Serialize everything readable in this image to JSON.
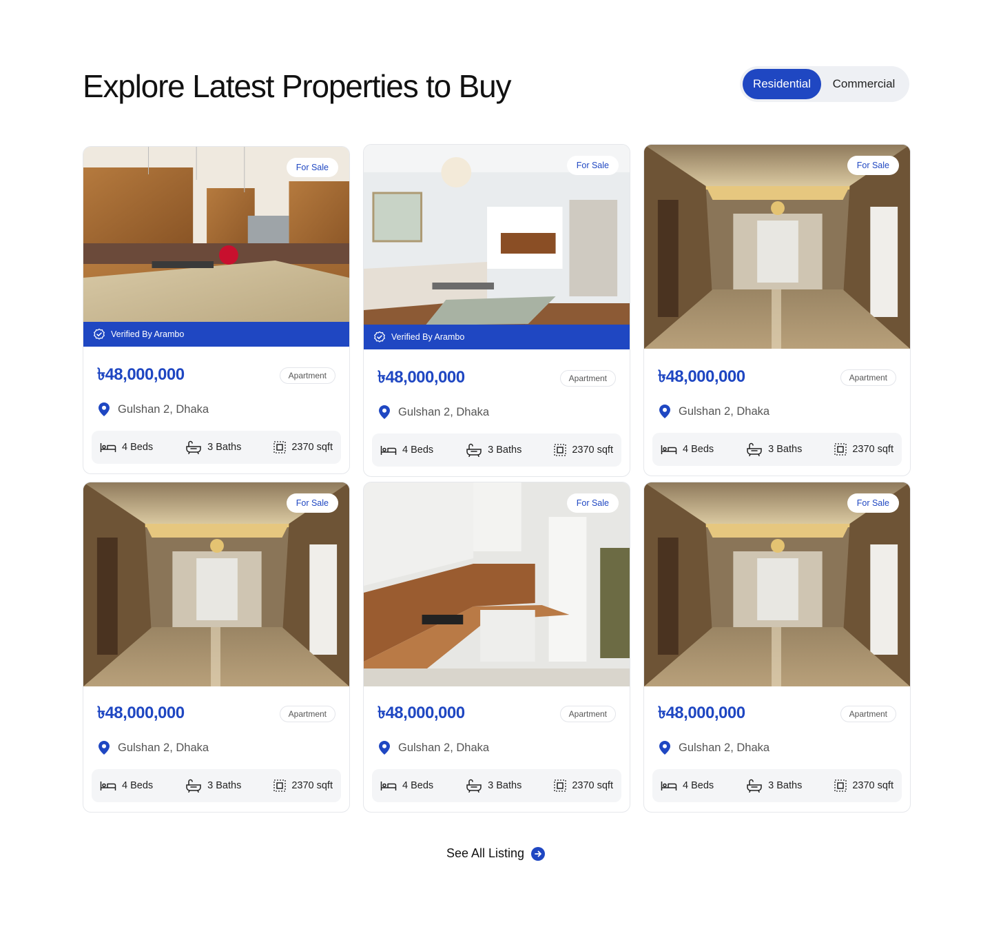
{
  "section": {
    "title": "Explore Latest Properties to Buy",
    "tabs": [
      {
        "label": "Residential",
        "active": true
      },
      {
        "label": "Commercial",
        "active": false
      }
    ]
  },
  "listings": [
    {
      "status": "For Sale",
      "verified_label": "Verified By Arambo",
      "price": "৳48,000,000",
      "type": "Apartment",
      "location": "Gulshan 2, Dhaka",
      "beds": "4 Beds",
      "baths": "3 Baths",
      "area": "2370 sqft",
      "photo": "kitchen-island"
    },
    {
      "status": "For Sale",
      "verified_label": "Verified By Arambo",
      "price": "৳48,000,000",
      "type": "Apartment",
      "location": "Gulshan 2, Dhaka",
      "beds": "4 Beds",
      "baths": "3 Baths",
      "area": "2370 sqft",
      "photo": "living-room"
    },
    {
      "status": "For Sale",
      "price": "৳48,000,000",
      "type": "Apartment",
      "location": "Gulshan 2, Dhaka",
      "beds": "4 Beds",
      "baths": "3 Baths",
      "area": "2370 sqft",
      "photo": "empty-hall"
    },
    {
      "status": "For Sale",
      "price": "৳48,000,000",
      "type": "Apartment",
      "location": "Gulshan 2, Dhaka",
      "beds": "4 Beds",
      "baths": "3 Baths",
      "area": "2370 sqft",
      "photo": "empty-hall"
    },
    {
      "status": "For Sale",
      "price": "৳48,000,000",
      "type": "Apartment",
      "location": "Gulshan 2, Dhaka",
      "beds": "4 Beds",
      "baths": "3 Baths",
      "area": "2370 sqft",
      "photo": "modern-kitchen"
    },
    {
      "status": "For Sale",
      "price": "৳48,000,000",
      "type": "Apartment",
      "location": "Gulshan 2, Dhaka",
      "beds": "4 Beds",
      "baths": "3 Baths",
      "area": "2370 sqft",
      "photo": "empty-hall"
    }
  ],
  "footer": {
    "see_all_label": "See All Listing"
  },
  "colors": {
    "accent": "#1f47c2",
    "pill_bg": "#eef0f4",
    "stats_bg": "#f4f5f7"
  },
  "icons": [
    "verified-icon",
    "location-pin-icon",
    "bed-icon",
    "bathtub-icon",
    "area-icon",
    "arrow-right-icon"
  ]
}
